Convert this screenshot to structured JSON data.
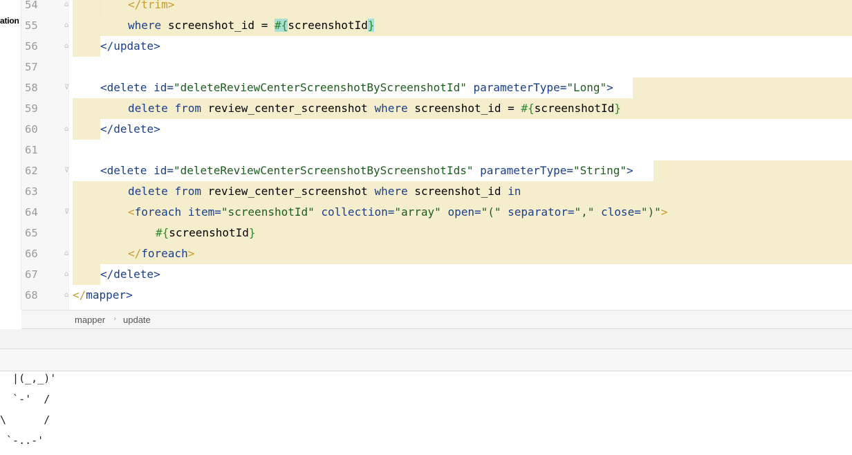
{
  "left_strip": {
    "label": "ation"
  },
  "editor": {
    "lines": [
      {
        "num": "54",
        "top": 0
      },
      {
        "num": "55"
      },
      {
        "num": "56"
      },
      {
        "num": "57"
      },
      {
        "num": "58"
      },
      {
        "num": "59"
      },
      {
        "num": "60"
      },
      {
        "num": "61"
      },
      {
        "num": "62"
      },
      {
        "num": "63"
      },
      {
        "num": "64"
      },
      {
        "num": "65"
      },
      {
        "num": "66"
      },
      {
        "num": "67"
      },
      {
        "num": "68"
      }
    ],
    "code": {
      "l54": "</trim>",
      "l55_kw": "where",
      "l55_col": "screenshot_id",
      "l55_eq": "=",
      "l55_ph_open": "#{",
      "l55_ph_name": "screenshotId",
      "l55_ph_close": "}",
      "l56": "</update>",
      "l58_tag": "<delete",
      "l58_attr1": "id=",
      "l58_val1": "\"deleteReviewCenterScreenshotByScreenshotId\"",
      "l58_attr2": "parameterType=",
      "l58_val2": "\"Long\"",
      "l58_end": ">",
      "l59_kw1": "delete",
      "l59_kw2": "from",
      "l59_table": "review_center_screenshot",
      "l59_kw3": "where",
      "l59_col": "screenshot_id",
      "l59_eq": "=",
      "l59_ph_open": "#{",
      "l59_ph_name": "screenshotId",
      "l59_ph_close": "}",
      "l60": "</delete>",
      "l62_tag": "<delete",
      "l62_attr1": "id=",
      "l62_val1": "\"deleteReviewCenterScreenshotByScreenshotIds\"",
      "l62_attr2": "parameterType=",
      "l62_val2": "\"String\"",
      "l62_end": ">",
      "l63_kw1": "delete",
      "l63_kw2": "from",
      "l63_table": "review_center_screenshot",
      "l63_kw3": "where",
      "l63_col": "screenshot_id",
      "l63_kw4": "in",
      "l64_open": "<",
      "l64_tag": "foreach",
      "l64_a1": "item=",
      "l64_v1": "\"screenshotId\"",
      "l64_a2": "collection=",
      "l64_v2": "\"array\"",
      "l64_a3": "open=",
      "l64_v3": "\"(\"",
      "l64_a4": "separator=",
      "l64_v4": "\",\"",
      "l64_a5": "close=",
      "l64_v5": "\")\"",
      "l64_end": ">",
      "l65_ph_open": "#{",
      "l65_ph_name": "screenshotId",
      "l65_ph_close": "}",
      "l66_open": "</",
      "l66_tag": "foreach",
      "l66_end": ">",
      "l67": "</delete>",
      "l68_open": "</",
      "l68_tag": "mapper",
      "l68_end": ">"
    }
  },
  "breadcrumb": {
    "items": [
      "mapper",
      "update"
    ],
    "separator": "›"
  },
  "console": {
    "lines": [
      "  |(_,_)'",
      "  `-'  /",
      "\\      /",
      " `-..-'"
    ]
  },
  "colors": {
    "highlight": "#f5eecc",
    "bracket_match": "#a8e0d6",
    "tag": "#1a3e8a",
    "value": "#1f5a1f",
    "placeholder": "#2f8a2f",
    "trim_tag": "#c99a2c"
  }
}
